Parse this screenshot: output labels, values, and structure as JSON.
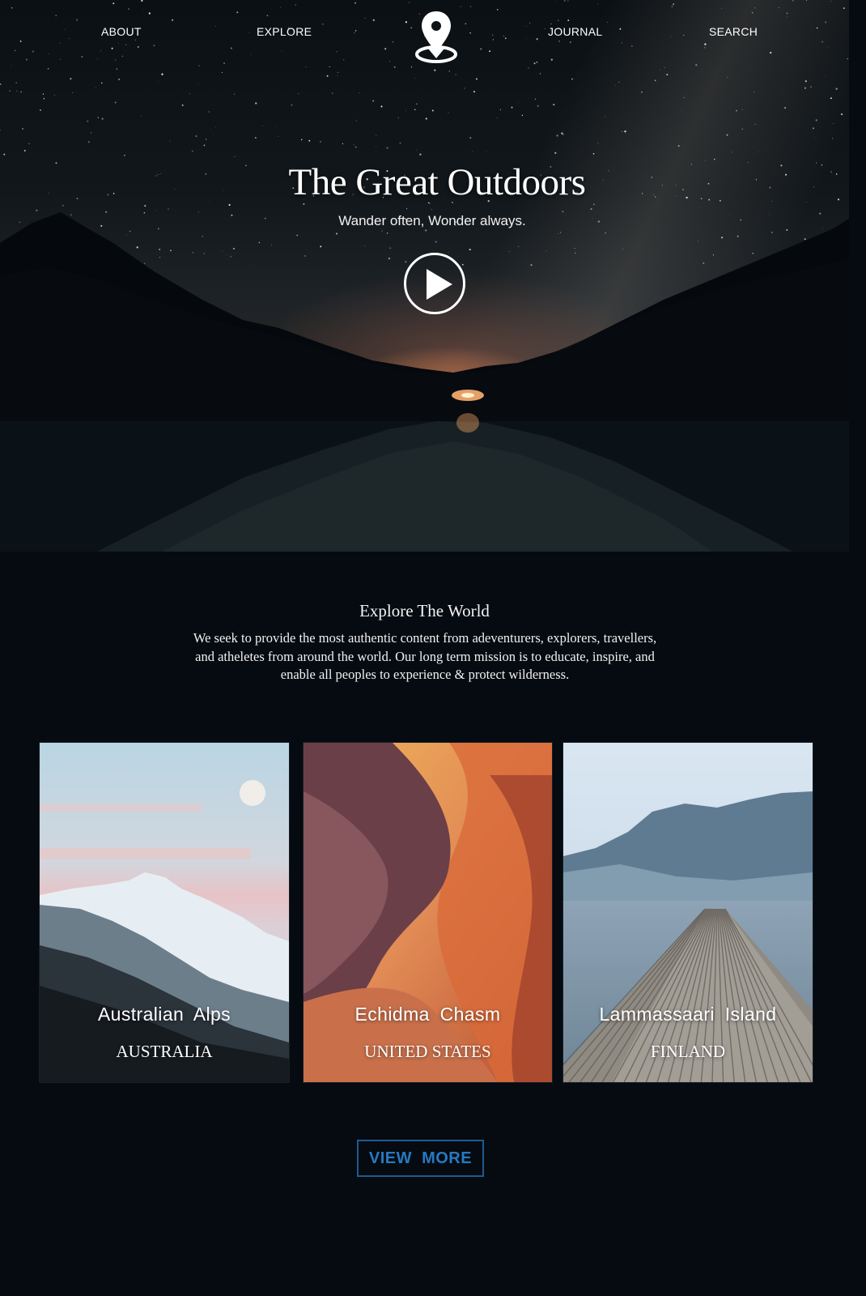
{
  "nav": {
    "items": [
      {
        "label": "ABOUT"
      },
      {
        "label": "EXPLORE"
      },
      {
        "label": "JOURNAL"
      },
      {
        "label": "SEARCH"
      }
    ],
    "logo_icon": "map-pin-icon"
  },
  "hero": {
    "title": "The  Great Outdoors",
    "subtitle": "Wander often, Wonder always.",
    "play_icon": "play-icon"
  },
  "intro": {
    "title": "Explore The World",
    "body": "We seek to provide the most authentic content from adeventurers, explorers, travellers, and atheletes from around the world. Our long term mission is to educate, inspire, and  enable all peoples to experience & protect wilderness."
  },
  "cards": [
    {
      "name": "Australian  Alps",
      "country": "AUSTRALIA"
    },
    {
      "name": "Echidma  Chasm",
      "country": "UNITED STATES"
    },
    {
      "name": "Lammassaari  Island",
      "country": "FINLAND"
    }
  ],
  "view_more": {
    "label": "VIEW  MORE"
  },
  "colors": {
    "background": "#050b11",
    "accent": "#2779c2",
    "accent_border": "#1e5a90",
    "text": "#ffffff"
  }
}
